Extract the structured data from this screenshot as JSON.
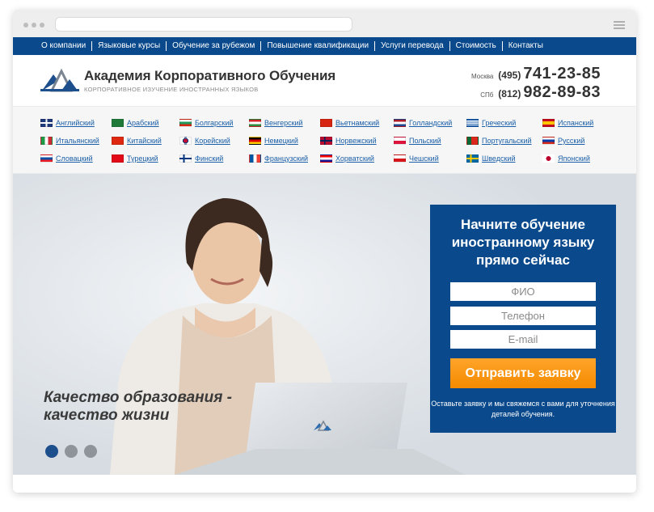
{
  "nav": {
    "items": [
      "О компании",
      "Языковые курсы",
      "Обучение за рубежом",
      "Повышение квалификации",
      "Услуги перевода",
      "Стоимость",
      "Контакты"
    ]
  },
  "brand": {
    "title": "Академия Корпоративного Обучения",
    "subtitle": "КОРПОРАТИВНОЕ ИЗУЧЕНИЕ ИНОСТРАННЫХ ЯЗЫКОВ"
  },
  "phones": [
    {
      "city": "Москва",
      "code": "(495)",
      "number": "741-23-85"
    },
    {
      "city": "СПб",
      "code": "(812)",
      "number": "982-89-83"
    }
  ],
  "languages": [
    {
      "label": "Английский",
      "flag": "uk-flag-icon"
    },
    {
      "label": "Арабский",
      "flag": "saudi-flag-icon"
    },
    {
      "label": "Болгарский",
      "flag": "bulgaria-flag-icon"
    },
    {
      "label": "Венгерский",
      "flag": "hungary-flag-icon"
    },
    {
      "label": "Вьетнамский",
      "flag": "vietnam-flag-icon"
    },
    {
      "label": "Голландский",
      "flag": "netherlands-flag-icon"
    },
    {
      "label": "Греческий",
      "flag": "greece-flag-icon"
    },
    {
      "label": "Испанский",
      "flag": "spain-flag-icon"
    },
    {
      "label": "Итальянский",
      "flag": "italy-flag-icon"
    },
    {
      "label": "Китайский",
      "flag": "china-flag-icon"
    },
    {
      "label": "Корейский",
      "flag": "korea-flag-icon"
    },
    {
      "label": "Немецкий",
      "flag": "germany-flag-icon"
    },
    {
      "label": "Норвежский",
      "flag": "norway-flag-icon"
    },
    {
      "label": "Польский",
      "flag": "poland-flag-icon"
    },
    {
      "label": "Португальский",
      "flag": "portugal-flag-icon"
    },
    {
      "label": "Русский",
      "flag": "russia-flag-icon"
    },
    {
      "label": "Словацкий",
      "flag": "slovakia-flag-icon"
    },
    {
      "label": "Турецкий",
      "flag": "turkey-flag-icon"
    },
    {
      "label": "Финский",
      "flag": "finland-flag-icon"
    },
    {
      "label": "Французский",
      "flag": "france-flag-icon"
    },
    {
      "label": "Хорватский",
      "flag": "croatia-flag-icon"
    },
    {
      "label": "Чешский",
      "flag": "czech-flag-icon"
    },
    {
      "label": "Шведский",
      "flag": "sweden-flag-icon"
    },
    {
      "label": "Японский",
      "flag": "japan-flag-icon"
    }
  ],
  "hero": {
    "slogan_line1": "Качество образования -",
    "slogan_line2": "качество жизни",
    "slide_count": 3,
    "active_slide": 1
  },
  "form": {
    "title": "Начните обучение иностранному языку прямо сейчас",
    "name_placeholder": "ФИО",
    "phone_placeholder": "Телефон",
    "email_placeholder": "E-mail",
    "submit_label": "Отправить заявку",
    "note": "Оставьте заявку и мы свяжемся с вами для уточнения деталей обучения."
  },
  "colors": {
    "brand_blue": "#0a4a8c",
    "accent_orange": "#f7960f",
    "link_blue": "#1a5fa8"
  }
}
